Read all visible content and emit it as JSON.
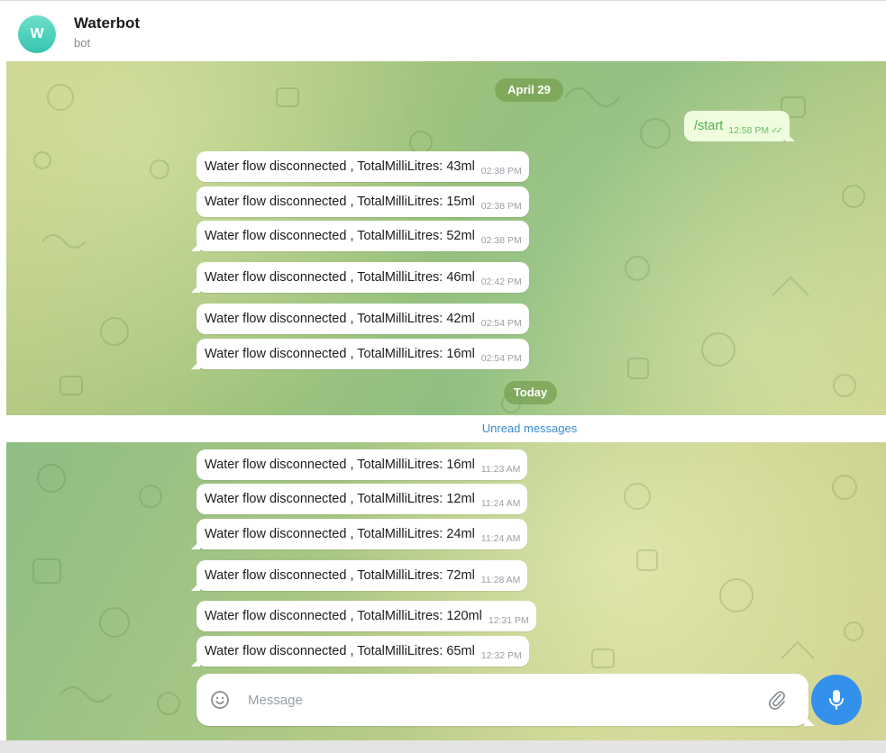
{
  "header": {
    "avatar_letter": "W",
    "title": "Waterbot",
    "subtitle": "bot",
    "avatar_color": "#4fd1bd"
  },
  "chat": {
    "date_separators": {
      "first": "April 29",
      "second": "Today"
    },
    "outgoing": {
      "text": "/start",
      "time": "12:58 PM",
      "status": "read"
    },
    "messages_before": [
      {
        "text": "Water flow disconnected , TotalMilliLitres: 43ml",
        "time": "02:38 PM"
      },
      {
        "text": "Water flow disconnected , TotalMilliLitres: 15ml",
        "time": "02:38 PM"
      },
      {
        "text": "Water flow disconnected , TotalMilliLitres: 52ml",
        "time": "02:38 PM"
      },
      {
        "text": "Water flow disconnected , TotalMilliLitres: 46ml",
        "time": "02:42 PM"
      },
      {
        "text": "Water flow disconnected , TotalMilliLitres: 42ml",
        "time": "02:54 PM"
      },
      {
        "text": "Water flow disconnected , TotalMilliLitres: 16ml",
        "time": "02:54 PM"
      }
    ],
    "unread_label": "Unread messages",
    "messages_after": [
      {
        "text": "Water flow disconnected , TotalMilliLitres: 16ml",
        "time": "11:23 AM"
      },
      {
        "text": "Water flow disconnected , TotalMilliLitres: 12ml",
        "time": "11:24 AM"
      },
      {
        "text": "Water flow disconnected , TotalMilliLitres: 24ml",
        "time": "11:24 AM"
      },
      {
        "text": "Water flow disconnected , TotalMilliLitres: 72ml",
        "time": "11:28 AM"
      },
      {
        "text": "Water flow disconnected , TotalMilliLitres: 120ml",
        "time": "12:31 PM"
      },
      {
        "text": "Water flow disconnected , TotalMilliLitres: 65ml",
        "time": "12:32 PM"
      }
    ]
  },
  "composer": {
    "placeholder": "Message",
    "value": "",
    "emoji_icon": "smile-icon",
    "attach_icon": "paperclip-icon",
    "send_icon": "microphone-icon",
    "accent_color": "#3390ec"
  }
}
